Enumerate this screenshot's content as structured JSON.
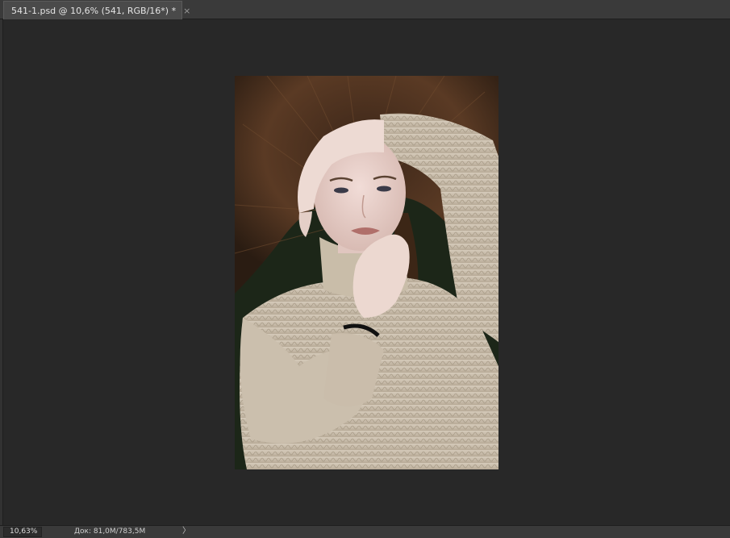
{
  "tab": {
    "title": "541-1.psd @ 10,6% (541, RGB/16*) *",
    "close_glyph": "×"
  },
  "statusbar": {
    "zoom": "10,63%",
    "doc_info": "Док: 81,0M/783,5M",
    "arrow_glyph": "〉"
  },
  "document": {
    "icon": "photo-portrait-image"
  }
}
